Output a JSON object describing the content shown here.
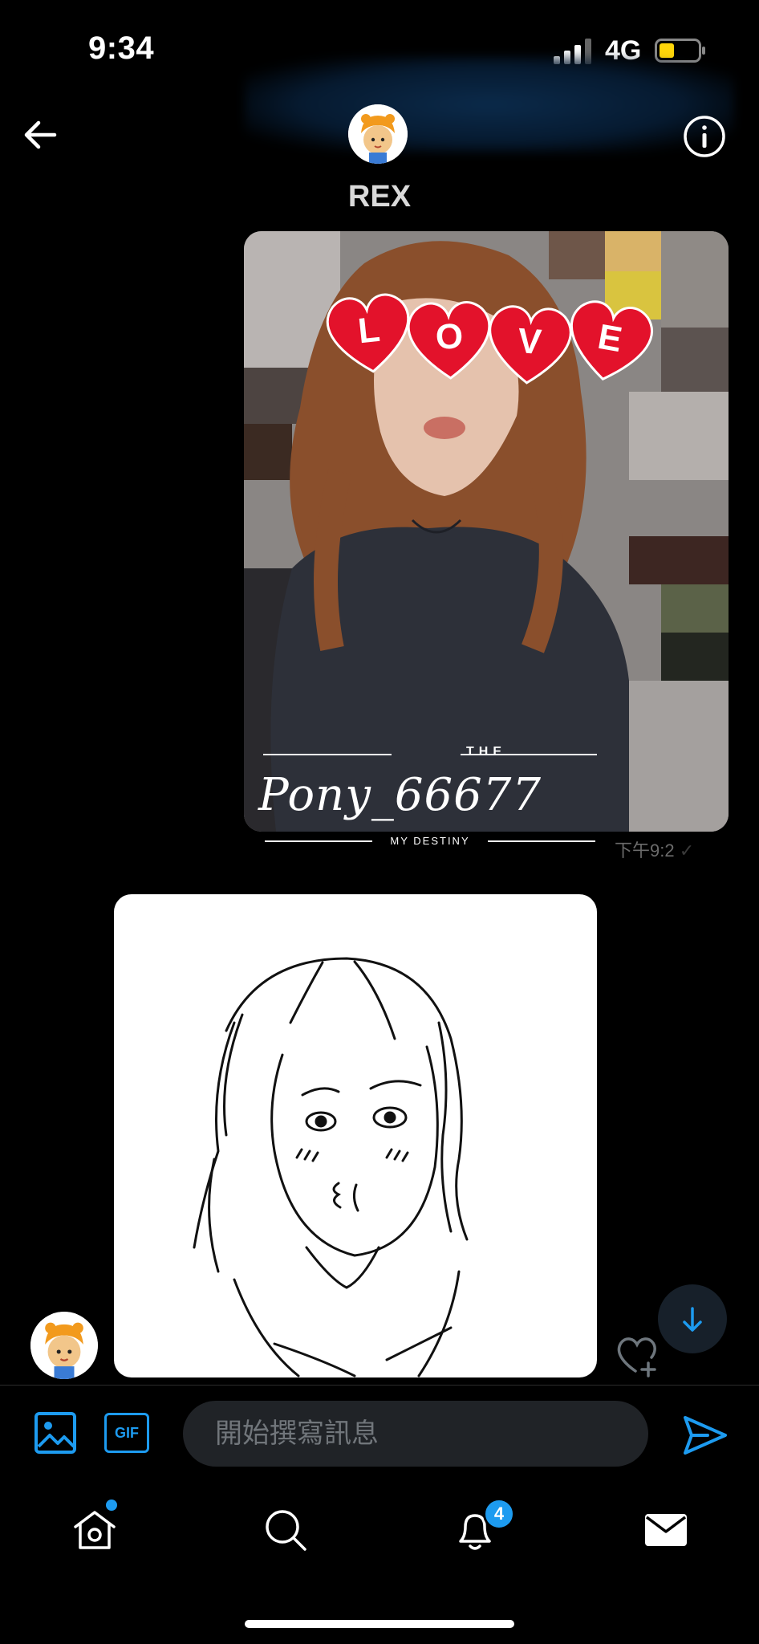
{
  "status_bar": {
    "time": "9:34",
    "network": "4G"
  },
  "header": {
    "title": "REX"
  },
  "messages": {
    "sent_photo": {
      "overlay_heart_letters": [
        "L",
        "O",
        "V",
        "E"
      ],
      "caption_top": "THE",
      "caption_username": "Pony_66677",
      "caption_bottom": "MY DESTINY",
      "timestamp": "下午9:2"
    },
    "received_drawing": {
      "description_icon": "drawing-portrait"
    }
  },
  "composer": {
    "gif_label": "GIF",
    "placeholder": "開始撰寫訊息"
  },
  "nav": {
    "notifications_badge": "4"
  },
  "colors": {
    "accent": "#1d9bf0",
    "background": "#000000",
    "heart": "#e3122b"
  }
}
